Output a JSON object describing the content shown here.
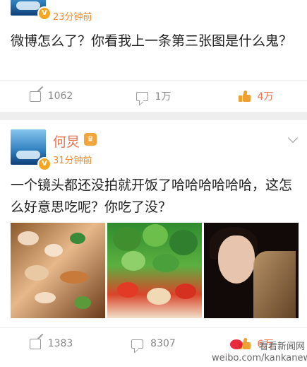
{
  "posts": [
    {
      "time": "23分钟前",
      "text": "微博怎么了？你看我上一条第三张图是什么鬼？",
      "actions": {
        "reposts": "1062",
        "comments": "1万",
        "likes": "4万"
      }
    },
    {
      "username": "何炅",
      "time": "31分钟前",
      "text": "一个镜头都还没拍就开饭了哈哈哈哈哈哈，这怎么好意思吃呢？你吃了没？",
      "actions": {
        "reposts": "1383",
        "comments": "8307",
        "likes": "6万"
      },
      "photos": [
        "seafood-dish-icon",
        "broccoli-tomato-dish-icon",
        "woman-portrait-icon"
      ]
    }
  ],
  "watermark": {
    "line1": "看看新闻网",
    "line2": "weibo.com/kankanews"
  },
  "colors": {
    "accent": "#eb7350",
    "time": "#f08c2b",
    "like": "#f0a030",
    "background": "#eeeeee"
  }
}
